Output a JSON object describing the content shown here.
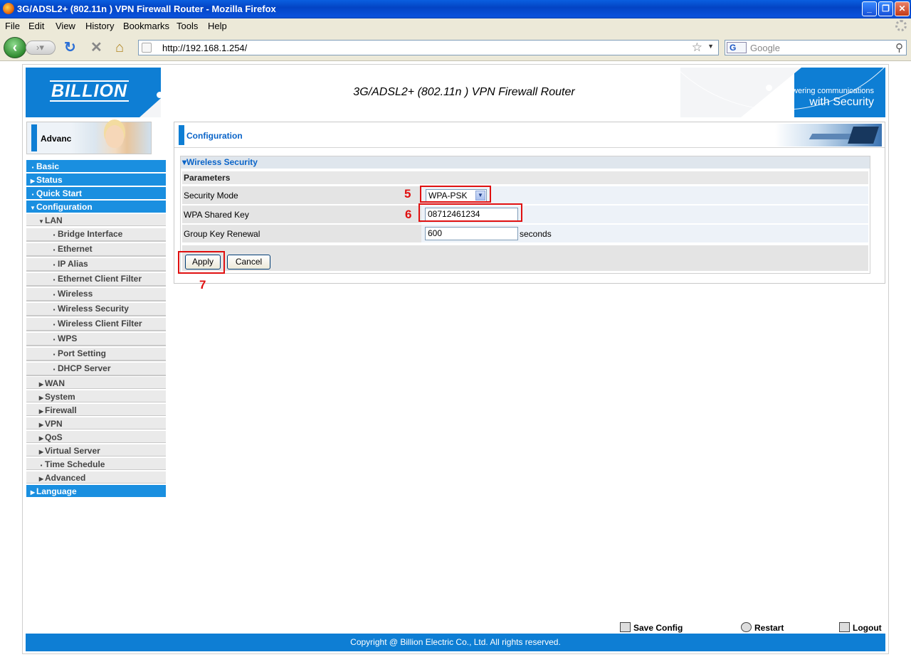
{
  "window": {
    "title": "3G/ADSL2+ (802.11n ) VPN Firewall Router - Mozilla Firefox",
    "controls": [
      "minimize",
      "maximize",
      "close"
    ]
  },
  "menu": {
    "items": [
      "File",
      "Edit",
      "View",
      "History",
      "Bookmarks",
      "Tools",
      "Help"
    ]
  },
  "toolbar": {
    "url": "http://192.168.1.254/",
    "search_engine": "G",
    "search_placeholder": "Google"
  },
  "banner": {
    "logo": "BILLION",
    "title": "3G/ADSL2+ (802.11n ) VPN Firewall Router",
    "tagline_top": "Powering communications",
    "tagline_bottom": "with Security"
  },
  "sidebar": {
    "mode_label": "Advanced",
    "items": [
      {
        "label": "Basic",
        "arrow": "▪",
        "style": "blue",
        "level": 0
      },
      {
        "label": "Status",
        "arrow": "▶",
        "style": "blue",
        "level": 0
      },
      {
        "label": "Quick Start",
        "arrow": "▪",
        "style": "blue",
        "level": 0
      },
      {
        "label": "Configuration",
        "arrow": "▼",
        "style": "blue",
        "level": 0
      },
      {
        "label": "LAN",
        "arrow": "▼",
        "style": "sub",
        "level": 1
      },
      {
        "label": "Bridge Interface",
        "arrow": "▪",
        "style": "sub2",
        "level": 2
      },
      {
        "label": "Ethernet",
        "arrow": "▪",
        "style": "sub2",
        "level": 2
      },
      {
        "label": "IP Alias",
        "arrow": "▪",
        "style": "sub2",
        "level": 2
      },
      {
        "label": "Ethernet Client Filter",
        "arrow": "▪",
        "style": "sub2",
        "level": 2
      },
      {
        "label": "Wireless",
        "arrow": "▪",
        "style": "sub2",
        "level": 2
      },
      {
        "label": "Wireless Security",
        "arrow": "▪",
        "style": "sub2",
        "level": 2
      },
      {
        "label": "Wireless Client Filter",
        "arrow": "▪",
        "style": "sub2",
        "level": 2
      },
      {
        "label": "WPS",
        "arrow": "▪",
        "style": "sub2",
        "level": 2
      },
      {
        "label": "Port Setting",
        "arrow": "▪",
        "style": "sub2",
        "level": 2
      },
      {
        "label": "DHCP Server",
        "arrow": "▪",
        "style": "sub2",
        "level": 2
      },
      {
        "label": "WAN",
        "arrow": "▶",
        "style": "sub",
        "level": 1
      },
      {
        "label": "System",
        "arrow": "▶",
        "style": "sub",
        "level": 1
      },
      {
        "label": "Firewall",
        "arrow": "▶",
        "style": "sub",
        "level": 1
      },
      {
        "label": "VPN",
        "arrow": "▶",
        "style": "sub",
        "level": 1
      },
      {
        "label": "QoS",
        "arrow": "▶",
        "style": "sub",
        "level": 1
      },
      {
        "label": "Virtual Server",
        "arrow": "▶",
        "style": "sub",
        "level": 1
      },
      {
        "label": "Time Schedule",
        "arrow": "▪",
        "style": "sub",
        "level": 1
      },
      {
        "label": "Advanced",
        "arrow": "▶",
        "style": "sub",
        "level": 1
      },
      {
        "label": "Language",
        "arrow": "▶",
        "style": "blue",
        "level": 0
      }
    ]
  },
  "main": {
    "header": "Configuration",
    "section_title": "Wireless Security",
    "params_label": "Parameters",
    "fields": {
      "security_mode": {
        "label": "Security Mode",
        "value": "WPA-PSK"
      },
      "wpa_key": {
        "label": "WPA Shared Key",
        "value": "08712461234"
      },
      "group_key": {
        "label": "Group Key Renewal",
        "value": "600",
        "unit": "seconds"
      }
    },
    "buttons": {
      "apply": "Apply",
      "cancel": "Cancel"
    },
    "callouts": {
      "mode": "5",
      "key": "6",
      "apply": "7"
    }
  },
  "footer": {
    "save": "Save Config",
    "restart": "Restart",
    "logout": "Logout",
    "copyright": "Copyright @ Billion Electric Co., Ltd. All rights reserved."
  },
  "colors": {
    "brand_blue": "#0e7ed4",
    "callout_red": "#e01010"
  }
}
